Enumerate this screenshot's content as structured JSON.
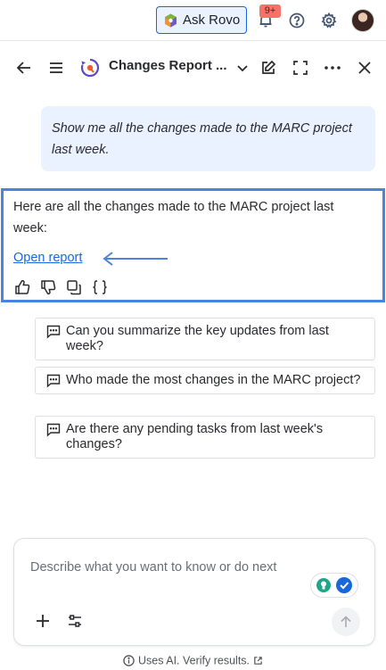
{
  "topbar": {
    "ask_rovo_label": "Ask Rovo",
    "notifications_badge": "9+"
  },
  "header": {
    "title": "Changes Report ..."
  },
  "conversation": {
    "user_message": "Show me all the changes made to the MARC project last week.",
    "ai_response": "Here are all the changes made to the MARC project last week:",
    "open_report_link": "Open report"
  },
  "suggestions": [
    "Can you summarize the key updates from last week?",
    "Who made the most changes in the MARC project?",
    "Are there any pending tasks from last week's changes?"
  ],
  "composer": {
    "placeholder": "Describe what you want to know or do next"
  },
  "footer": {
    "disclaimer": "Uses AI. Verify results."
  },
  "colors": {
    "accent": "#1868db",
    "highlight_border": "#4a84dc",
    "user_bubble": "#e9f2fe",
    "badge": "#f87168"
  }
}
